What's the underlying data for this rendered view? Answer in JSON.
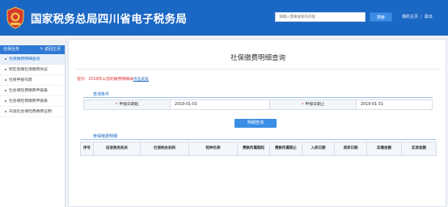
{
  "header": {
    "title": "国家税务总局四川省电子税务局",
    "search_placeholder": "请输入需要搜索的内容",
    "search_button": "搜索",
    "links": [
      "我的主页",
      "退出"
    ],
    "bg_color": "#1a67c4"
  },
  "sidebar": {
    "title": "社保业务",
    "back_label": "返回主页",
    "items": [
      {
        "label": "社保缴费明细查询",
        "active": true
      },
      {
        "label": "跨区划缴社保缴费协议",
        "active": false
      },
      {
        "label": "社保申报作废",
        "active": false
      },
      {
        "label": "社会保险费缴费申报表",
        "active": false
      },
      {
        "label": "社会保险费缴费申报表",
        "active": false
      },
      {
        "label": "开具社会保险费缴费证明",
        "active": false
      }
    ]
  },
  "main": {
    "page_title": "社保缴费明细查询",
    "notice_text": "提示：2019年以前的缴费明细请",
    "notice_link": "点击此处",
    "query_section": "查询条件",
    "start_label": "申报日期起",
    "start_value": "2019-01-01",
    "end_label": "申报日期止",
    "end_value": "2019-01-31",
    "query_button": "明细查询",
    "result_section": "参保缴费明细",
    "columns": [
      "序号",
      "征收税务机关",
      "社保经办机构",
      "险种名称",
      "费款所属期起",
      "费款所属期止",
      "入库日期",
      "退库日期",
      "实缴金额",
      "实退金额"
    ]
  }
}
